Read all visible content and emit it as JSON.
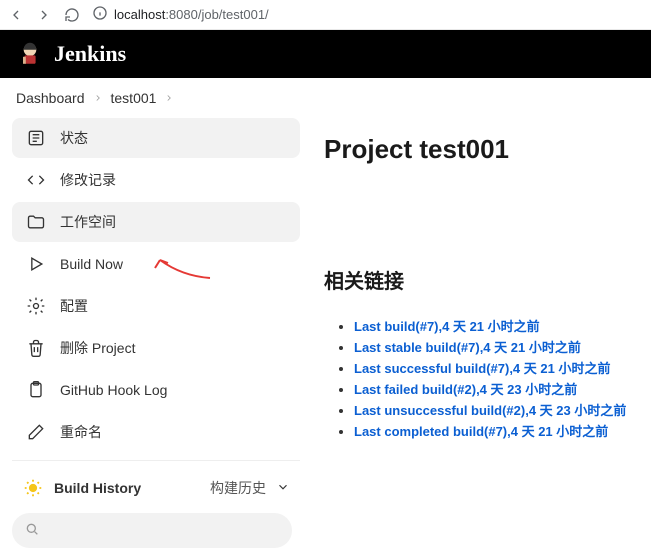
{
  "browser": {
    "url_prefix": "localhost",
    "url_rest": ":8080/job/test001/"
  },
  "header": {
    "title": "Jenkins"
  },
  "breadcrumbs": [
    "Dashboard",
    "test001"
  ],
  "sidebar": {
    "items": [
      {
        "label": "状态"
      },
      {
        "label": "修改记录"
      },
      {
        "label": "工作空间"
      },
      {
        "label": "Build Now"
      },
      {
        "label": "配置"
      },
      {
        "label": "删除 Project"
      },
      {
        "label": "GitHub Hook Log"
      },
      {
        "label": "重命名"
      }
    ],
    "buildHistory": {
      "title": "Build History",
      "subtitle": "构建历史"
    }
  },
  "content": {
    "title": "Project test001",
    "relatedHeading": "相关链接",
    "links": [
      "Last build(#7),4 天 21 小时之前",
      "Last stable build(#7),4 天 21 小时之前",
      "Last successful build(#7),4 天 21 小时之前",
      "Last failed build(#2),4 天 23 小时之前",
      "Last unsuccessful build(#2),4 天 23 小时之前",
      "Last completed build(#7),4 天 21 小时之前"
    ]
  }
}
